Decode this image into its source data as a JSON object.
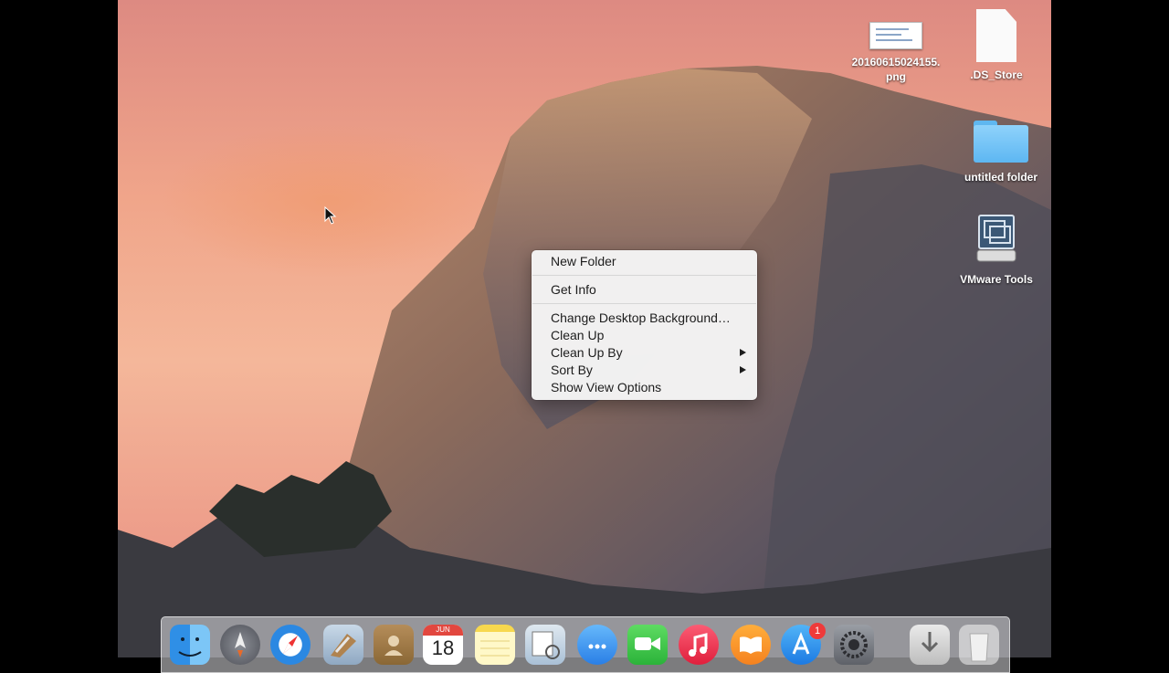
{
  "desktop": {
    "icons": [
      {
        "label": "20160615024155.\npng",
        "kind": "png-thumbnail"
      },
      {
        "label": ".DS_Store",
        "kind": "document"
      },
      {
        "label": "untitled folder",
        "kind": "folder"
      },
      {
        "label": "VMware Tools",
        "kind": "vmware-disk"
      }
    ]
  },
  "context_menu": {
    "items": [
      {
        "label": "New Folder",
        "submenu": false
      },
      {
        "label": "Get Info",
        "submenu": false
      },
      {
        "label": "Change Desktop Background…",
        "submenu": false
      },
      {
        "label": "Clean Up",
        "submenu": false
      },
      {
        "label": "Clean Up By",
        "submenu": true
      },
      {
        "label": "Sort By",
        "submenu": true
      },
      {
        "label": "Show View Options",
        "submenu": false
      }
    ]
  },
  "dock": {
    "apps": [
      {
        "name": "Finder",
        "icon": "finder-icon"
      },
      {
        "name": "Launchpad",
        "icon": "launchpad-icon"
      },
      {
        "name": "Safari",
        "icon": "safari-icon"
      },
      {
        "name": "Mail",
        "icon": "mail-icon"
      },
      {
        "name": "Contacts",
        "icon": "contacts-icon"
      },
      {
        "name": "Calendar",
        "icon": "calendar-icon",
        "month": "JUN",
        "day": "18"
      },
      {
        "name": "Notes",
        "icon": "notes-icon"
      },
      {
        "name": "Preview",
        "icon": "preview-icon"
      },
      {
        "name": "Messages",
        "icon": "messages-icon"
      },
      {
        "name": "FaceTime",
        "icon": "facetime-icon"
      },
      {
        "name": "iTunes",
        "icon": "itunes-icon"
      },
      {
        "name": "iBooks",
        "icon": "ibooks-icon"
      },
      {
        "name": "App Store",
        "icon": "app-store-icon",
        "badge": "1"
      },
      {
        "name": "System Preferences",
        "icon": "system-preferences-icon"
      },
      {
        "name": "Downloads",
        "icon": "downloads-icon"
      },
      {
        "name": "Trash",
        "icon": "trash-icon"
      }
    ]
  },
  "colors": {
    "menu_bg": "#f5f5f5",
    "folder_blue": "#5db7f2",
    "badge_red": "#ef3a3a"
  }
}
